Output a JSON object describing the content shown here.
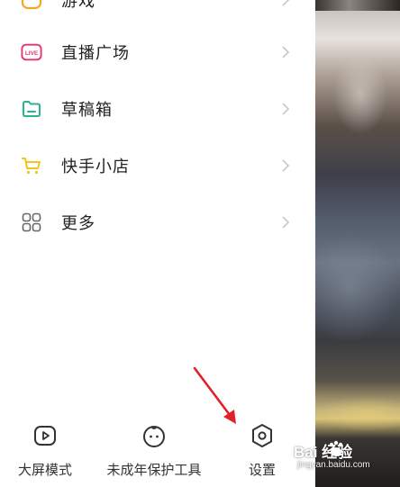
{
  "menu": {
    "items": [
      {
        "label": "游戏",
        "icon": "game-icon"
      },
      {
        "label": "直播广场",
        "icon": "live-icon"
      },
      {
        "label": "草稿箱",
        "icon": "folder-icon"
      },
      {
        "label": "快手小店",
        "icon": "shopping-cart-icon"
      },
      {
        "label": "更多",
        "icon": "grid-icon"
      }
    ]
  },
  "live_badge": "LIVE",
  "bottom_bar": {
    "big_screen": "大屏模式",
    "minor_protection": "未成年保护工具",
    "settings": "设置"
  },
  "watermark": {
    "brand": "Bai 经验",
    "url": "jingyan.baidu.com"
  },
  "colors": {
    "game": "#f5a623",
    "live": "#e8336d",
    "folder": "#2bb58e",
    "cart": "#f5c518",
    "arrow": "#e0202a"
  }
}
